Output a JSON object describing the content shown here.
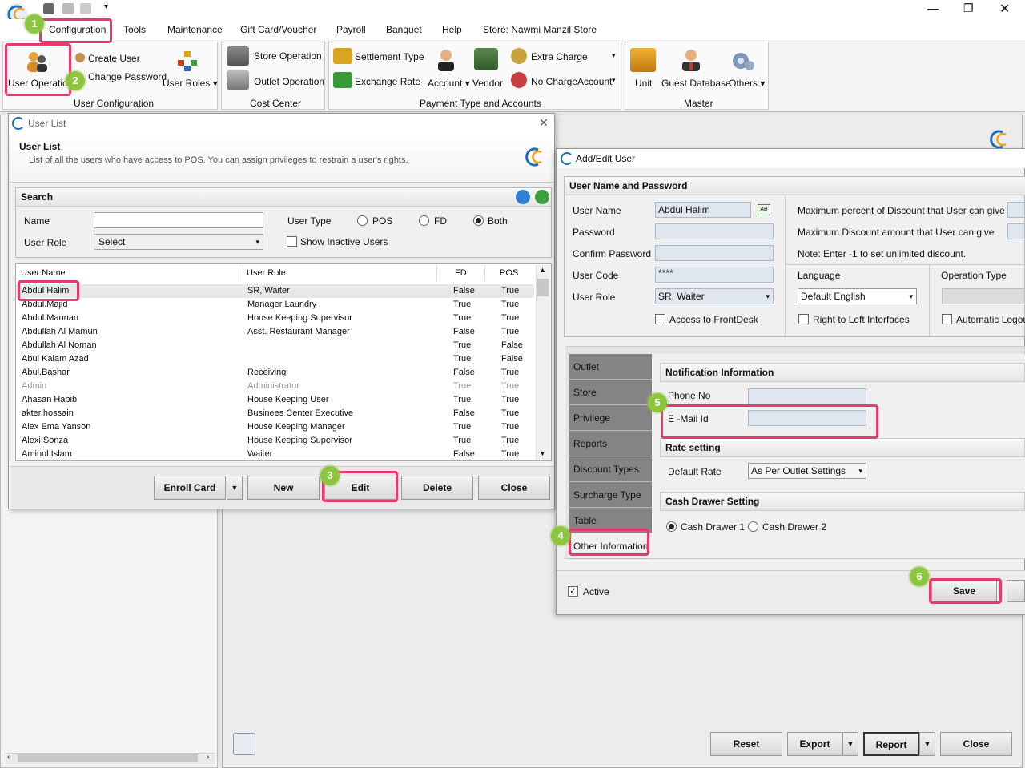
{
  "menu": {
    "items": [
      "Configuration",
      "Tools",
      "Maintenance",
      "Gift Card/Voucher",
      "Payroll",
      "Banquet",
      "Help",
      "Store: Nawmi Manzil Store"
    ]
  },
  "ribbon": {
    "user_operation": "User Operation",
    "create_user": "Create User",
    "change_password": "Change Password",
    "user_roles": "User Roles",
    "group_user_config": "User Configuration",
    "store_operation": "Store Operation",
    "outlet_operation": "Outlet Operation",
    "group_cost_center": "Cost Center",
    "settlement_type": "Settlement Type",
    "exchange_rate": "Exchange Rate",
    "account": "Account",
    "vendor": "Vendor",
    "extra_charge": "Extra Charge",
    "no_charge_account": "No ChargeAccount",
    "group_payment": "Payment Type and Accounts",
    "unit": "Unit",
    "guest_database": "Guest Database",
    "others": "Others",
    "group_master": "Master"
  },
  "user_list": {
    "window_title": "User List",
    "heading": "User List",
    "description": "List of all the users who have access to POS. You can assign privileges to restrain a user's rights.",
    "search_title": "Search",
    "name_label": "Name",
    "name_value": "",
    "role_label": "User Role",
    "role_value": "Select",
    "user_type_label": "User Type",
    "pos_label": "POS",
    "fd_label": "FD",
    "both_label": "Both",
    "inactive_label": "Show Inactive Users",
    "columns": [
      "User Name",
      "User Role",
      "FD",
      "POS"
    ],
    "rows": [
      {
        "name": "Abdul Halim",
        "role": "SR, Waiter",
        "fd": "False",
        "pos": "True"
      },
      {
        "name": "Abdul.Majid",
        "role": "Manager Laundry",
        "fd": "True",
        "pos": "True"
      },
      {
        "name": "Abdul.Mannan",
        "role": "House Keeping Supervisor",
        "fd": "True",
        "pos": "True"
      },
      {
        "name": "Abdullah Al Mamun",
        "role": "Asst. Restaurant Manager",
        "fd": "False",
        "pos": "True"
      },
      {
        "name": "Abdullah Al Noman",
        "role": "",
        "fd": "True",
        "pos": "False"
      },
      {
        "name": "Abul Kalam Azad",
        "role": "",
        "fd": "True",
        "pos": "False"
      },
      {
        "name": "Abul.Bashar",
        "role": "Receiving",
        "fd": "False",
        "pos": "True"
      },
      {
        "name": "Admin",
        "role": "Administrator",
        "fd": "True",
        "pos": "True"
      },
      {
        "name": "Ahasan Habib",
        "role": "House Keeping User",
        "fd": "True",
        "pos": "True"
      },
      {
        "name": "akter.hossain",
        "role": "Businees Center Executive",
        "fd": "False",
        "pos": "True"
      },
      {
        "name": "Alex Ema Yanson",
        "role": "House Keeping Manager",
        "fd": "True",
        "pos": "True"
      },
      {
        "name": "Alexi.Sonza",
        "role": "House Keeping Supervisor",
        "fd": "True",
        "pos": "True"
      },
      {
        "name": "Aminul Islam",
        "role": "Waiter",
        "fd": "False",
        "pos": "True"
      }
    ],
    "buttons": {
      "enroll": "Enroll Card",
      "new": "New",
      "edit": "Edit",
      "delete": "Delete",
      "close": "Close"
    }
  },
  "add_edit": {
    "window_title": "Add/Edit User",
    "section_title": "User Name and Password",
    "user_name_label": "User Name",
    "user_name_value": "Abdul Halim",
    "password_label": "Password",
    "confirm_label": "Confirm Password",
    "code_label": "User Code",
    "code_value": "****",
    "role_label": "User Role",
    "role_value": "SR, Waiter",
    "frontdesk_label": "Access to FrontDesk",
    "max_percent_label": "Maximum percent of Discount that User can give",
    "max_amount_label": "Maximum Discount amount that User can give",
    "note": "Note: Enter -1 to set unlimited discount.",
    "language_label": "Language",
    "language_value": "Default English",
    "rtl_label": "Right to Left Interfaces",
    "op_type_label": "Operation Type",
    "auto_logout_label": "Automatic Logout",
    "tabs": [
      "Outlet",
      "Store",
      "Privilege",
      "Reports",
      "Discount Types",
      "Surcharge Type",
      "Table",
      "Other Information"
    ],
    "notification_title": "Notification Information",
    "phone_label": "Phone No",
    "email_label": "E -Mail Id",
    "rate_title": "Rate setting",
    "default_rate_label": "Default Rate",
    "default_rate_value": "As Per Outlet Settings",
    "drawer_title": "Cash Drawer Setting",
    "drawer1": "Cash Drawer 1",
    "drawer2": "Cash Drawer 2",
    "active_label": "Active",
    "save": "Save"
  },
  "bottom_buttons": {
    "reset": "Reset",
    "export": "Export",
    "report": "Report",
    "close": "Close"
  },
  "steps": [
    "1",
    "2",
    "3",
    "4",
    "5",
    "6"
  ],
  "colors": {
    "highlight": "#e8396b",
    "badge": "#8cc63f",
    "tab_dark": "#848484"
  }
}
